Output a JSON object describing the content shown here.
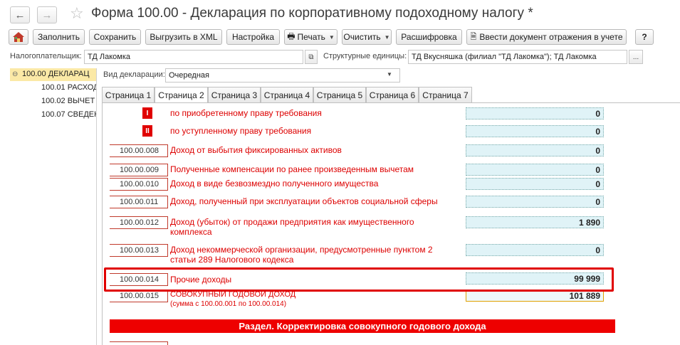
{
  "window": {
    "title": "Форма 100.00 - Декларация по корпоративному подоходному налогу *"
  },
  "toolbar": {
    "fill": "Заполнить",
    "save": "Сохранить",
    "export_xml": "Выгрузить в XML",
    "settings": "Настройка",
    "print": "Печать",
    "clear": "Очистить",
    "decode": "Расшифровка",
    "reflect_doc": "Ввести документ отражения в учете",
    "help": "?"
  },
  "fields": {
    "taxpayer_label": "Налогоплательщик:",
    "taxpayer_value": "ТД Лакомка",
    "units_label": "Структурные единицы:",
    "units_value": "ТД Вкусняшка (филиал \"ТД Лакомка\"); ТД Лакомка",
    "units_button": "...",
    "decl_type_label": "Вид декларации:",
    "decl_type_value": "Очередная"
  },
  "tree": [
    {
      "label": "100.00 ДЕКЛАРАЦ"
    },
    {
      "label": "100.01 РАСХОД"
    },
    {
      "label": "100.02 ВЫЧЕТ"
    },
    {
      "label": "100.07 СВЕДЕН"
    }
  ],
  "tabs": [
    "Страница 1",
    "Страница 2",
    "Страница 3",
    "Страница 4",
    "Страница 5",
    "Страница 6",
    "Страница 7"
  ],
  "rows": [
    {
      "roman": "I",
      "label": "по приобретенному праву требования",
      "value": "0"
    },
    {
      "roman": "II",
      "label": "по уступленному праву требования",
      "value": "0"
    },
    {
      "code": "100.00.008",
      "label": "Доход от выбытия фиксированных активов",
      "value": "0"
    },
    {
      "code": "100.00.009",
      "label": "Полученные компенсации по ранее произведенным вычетам",
      "value": "0"
    },
    {
      "code": "100.00.010",
      "label": "Доход в виде безвозмездно полученного имущества",
      "value": "0"
    },
    {
      "code": "100.00.011",
      "label": "Доход, полученный при эксплуатации объектов социальной сферы",
      "value": "0"
    },
    {
      "code": "100.00.012",
      "label": "Доход (убыток) от продажи предприятия как имущественного комплекса",
      "value": "1 890"
    },
    {
      "code": "100.00.013",
      "label": "Доход некоммерческой организации, предусмотренные пунктом 2 статьи 289 Налогового кодекса",
      "value": "0"
    },
    {
      "code": "100.00.014",
      "label": "Прочие доходы",
      "value": "99 999"
    },
    {
      "code": "100.00.015",
      "label": "СОВОКУПНЫЙ ГОДОВОЙ ДОХОД",
      "sublabel": "(сумма с 100.00.001 по 100.00.014)",
      "value": "101 889"
    }
  ],
  "section_header": "Раздел. Корректировка совокупного годового дохода",
  "colors": {
    "accent_red": "#ee0000",
    "value_bg": "#e0f3f7",
    "selected_tree": "#fbe9a6"
  }
}
